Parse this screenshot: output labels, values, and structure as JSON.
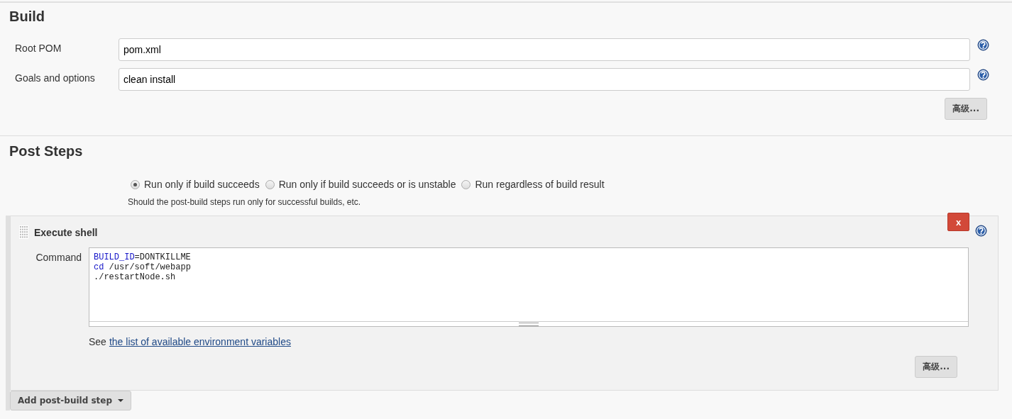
{
  "build": {
    "title": "Build",
    "fields": [
      {
        "label": "Root POM",
        "value": "pom.xml"
      },
      {
        "label": "Goals and options",
        "value": "clean install"
      }
    ],
    "advanced_button": "高级..."
  },
  "post_steps": {
    "title": "Post Steps",
    "options": [
      {
        "label": "Run only if build succeeds",
        "selected": true
      },
      {
        "label": "Run only if build succeeds or is unstable",
        "selected": false
      },
      {
        "label": "Run regardless of build result",
        "selected": false
      }
    ],
    "hint": "Should the post-build steps run only for successful builds, etc.",
    "step": {
      "title": "Execute shell",
      "delete_button": "x",
      "command_label": "Command",
      "command_lines": [
        [
          {
            "text": "BUILD_ID",
            "kind": "keyword"
          },
          {
            "text": "=DONTKILLME",
            "kind": "plain"
          }
        ],
        [
          {
            "text": "cd",
            "kind": "keyword"
          },
          {
            "text": " /usr/soft/webapp",
            "kind": "plain"
          }
        ],
        [
          {
            "text": "./restartNode.sh",
            "kind": "plain"
          }
        ]
      ],
      "see_text": "See",
      "link": "the list of available environment variables",
      "advanced_button": "高级..."
    },
    "add_button": "Add post-build step"
  }
}
